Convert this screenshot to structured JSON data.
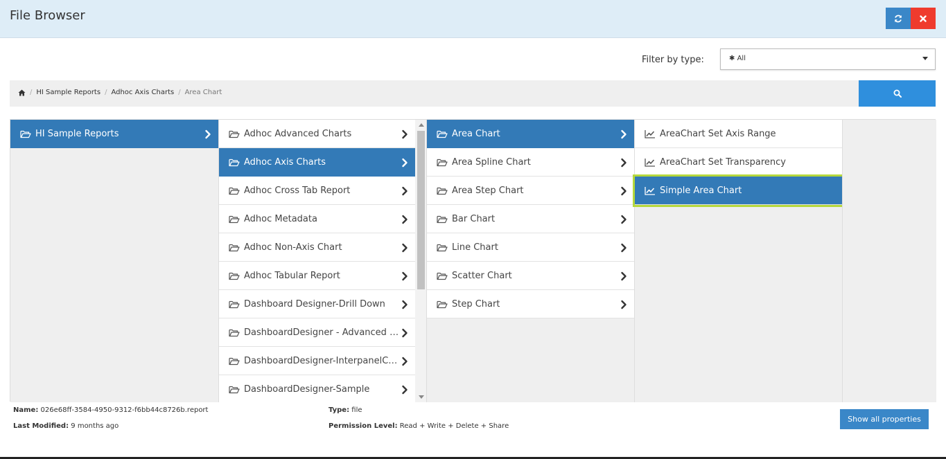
{
  "header": {
    "title": "File Browser",
    "refresh_icon": "refresh-icon",
    "close_icon": "close-icon",
    "refresh_color": "#3a87c8",
    "close_color": "#ef3b2d"
  },
  "filter": {
    "label": "Filter by type:",
    "selected": "All",
    "selected_icon": "asterisk-icon"
  },
  "breadcrumb": {
    "home_icon": "home-icon",
    "items": [
      "HI Sample Reports",
      "Adhoc Axis Charts"
    ],
    "current": "Area Chart"
  },
  "search": {
    "icon": "search-icon"
  },
  "columns": {
    "col1": [
      {
        "label": "HI Sample Reports",
        "icon": "folder-open-icon",
        "selected": true
      }
    ],
    "col2": [
      {
        "label": "Adhoc Advanced Charts"
      },
      {
        "label": "Adhoc Axis Charts",
        "selected": true
      },
      {
        "label": "Adhoc Cross Tab Report"
      },
      {
        "label": "Adhoc Metadata"
      },
      {
        "label": "Adhoc Non-Axis Chart"
      },
      {
        "label": "Adhoc Tabular Report"
      },
      {
        "label": "Dashboard Designer-Drill Down"
      },
      {
        "label": "DashboardDesigner - Advanced M..."
      },
      {
        "label": "DashboardDesigner-InterpanelCo..."
      },
      {
        "label": "DashboardDesigner-Sample"
      }
    ],
    "col3": [
      {
        "label": "Area Chart",
        "selected": true
      },
      {
        "label": "Area Spline Chart"
      },
      {
        "label": "Area Step Chart"
      },
      {
        "label": "Bar Chart"
      },
      {
        "label": "Line Chart"
      },
      {
        "label": "Scatter Chart"
      },
      {
        "label": "Step Chart"
      }
    ],
    "col4": [
      {
        "label": "AreaChart Set Axis Range",
        "icon": "line-chart-icon"
      },
      {
        "label": "AreaChart Set Transparency",
        "icon": "line-chart-icon"
      },
      {
        "label": "Simple Area Chart",
        "icon": "line-chart-icon",
        "selected": true
      }
    ]
  },
  "details": {
    "name_label": "Name:",
    "name_value": "026e68ff-3584-4950-9312-f6bb44c8726b.report",
    "modified_label": "Last Modified:",
    "modified_value": "9 months ago",
    "type_label": "Type:",
    "type_value": "file",
    "permission_label": "Permission Level:",
    "permission_value": "Read + Write + Delete + Share",
    "show_props_label": "Show all properties"
  },
  "colors": {
    "selected_bg": "#337ab7",
    "highlight_outline": "#b5d83c",
    "search_button": "#2f8fdd",
    "header_bg": "#deedf7"
  }
}
